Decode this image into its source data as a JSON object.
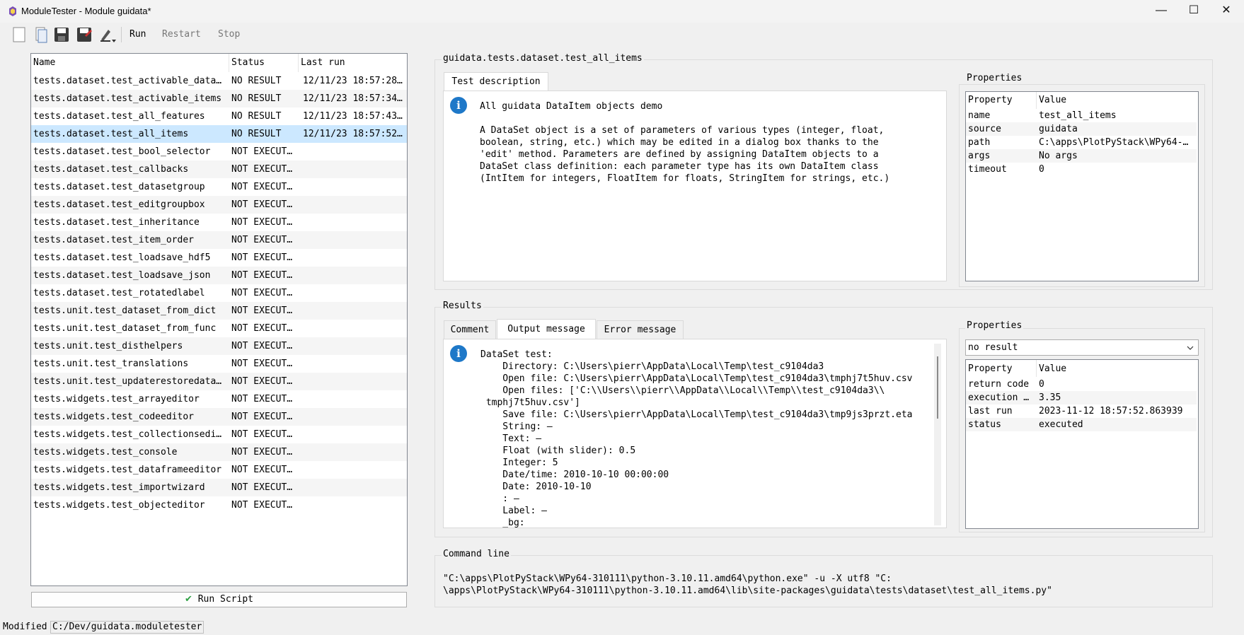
{
  "window": {
    "title": "ModuleTester - Module guidata*",
    "minimize": "—",
    "maximize": "☐",
    "close": "✕"
  },
  "toolbar": {
    "run": "Run",
    "restart": "Restart",
    "stop": "Stop"
  },
  "tree": {
    "headers": {
      "name": "Name",
      "status": "Status",
      "last_run": "Last run"
    },
    "rows": [
      {
        "name": "tests.dataset.test_activable_data…",
        "status": "NO RESULT",
        "last_run": "12/11/23 18:57:28…"
      },
      {
        "name": "tests.dataset.test_activable_items",
        "status": "NO RESULT",
        "last_run": "12/11/23 18:57:34…"
      },
      {
        "name": "tests.dataset.test_all_features",
        "status": "NO RESULT",
        "last_run": "12/11/23 18:57:43…"
      },
      {
        "name": "tests.dataset.test_all_items",
        "status": "NO RESULT",
        "last_run": "12/11/23 18:57:52…"
      },
      {
        "name": "tests.dataset.test_bool_selector",
        "status": "NOT EXECUT…",
        "last_run": ""
      },
      {
        "name": "tests.dataset.test_callbacks",
        "status": "NOT EXECUT…",
        "last_run": ""
      },
      {
        "name": "tests.dataset.test_datasetgroup",
        "status": "NOT EXECUT…",
        "last_run": ""
      },
      {
        "name": "tests.dataset.test_editgroupbox",
        "status": "NOT EXECUT…",
        "last_run": ""
      },
      {
        "name": "tests.dataset.test_inheritance",
        "status": "NOT EXECUT…",
        "last_run": ""
      },
      {
        "name": "tests.dataset.test_item_order",
        "status": "NOT EXECUT…",
        "last_run": ""
      },
      {
        "name": "tests.dataset.test_loadsave_hdf5",
        "status": "NOT EXECUT…",
        "last_run": ""
      },
      {
        "name": "tests.dataset.test_loadsave_json",
        "status": "NOT EXECUT…",
        "last_run": ""
      },
      {
        "name": "tests.dataset.test_rotatedlabel",
        "status": "NOT EXECUT…",
        "last_run": ""
      },
      {
        "name": "tests.unit.test_dataset_from_dict",
        "status": "NOT EXECUT…",
        "last_run": ""
      },
      {
        "name": "tests.unit.test_dataset_from_func",
        "status": "NOT EXECUT…",
        "last_run": ""
      },
      {
        "name": "tests.unit.test_disthelpers",
        "status": "NOT EXECUT…",
        "last_run": ""
      },
      {
        "name": "tests.unit.test_translations",
        "status": "NOT EXECUT…",
        "last_run": ""
      },
      {
        "name": "tests.unit.test_updaterestoredata…",
        "status": "NOT EXECUT…",
        "last_run": ""
      },
      {
        "name": "tests.widgets.test_arrayeditor",
        "status": "NOT EXECUT…",
        "last_run": ""
      },
      {
        "name": "tests.widgets.test_codeeditor",
        "status": "NOT EXECUT…",
        "last_run": ""
      },
      {
        "name": "tests.widgets.test_collectionsedi…",
        "status": "NOT EXECUT…",
        "last_run": ""
      },
      {
        "name": "tests.widgets.test_console",
        "status": "NOT EXECUT…",
        "last_run": ""
      },
      {
        "name": "tests.widgets.test_dataframeeditor",
        "status": "NOT EXECUT…",
        "last_run": ""
      },
      {
        "name": "tests.widgets.test_importwizard",
        "status": "NOT EXECUT…",
        "last_run": ""
      },
      {
        "name": "tests.widgets.test_objecteditor",
        "status": "NOT EXECUT…",
        "last_run": ""
      }
    ],
    "selected_index": 3
  },
  "run_script_label": "Run Script",
  "module_title": "guidata.tests.dataset.test_all_items",
  "description": {
    "tab": "Test description",
    "text": "All guidata DataItem objects demo\n\nA DataSet object is a set of parameters of various types (integer, float,\nboolean, string, etc.) which may be edited in a dialog box thanks to the\n'edit' method. Parameters are defined by assigning DataItem objects to a\nDataSet class definition: each parameter type has its own DataItem class\n(IntItem for integers, FloatItem for floats, StringItem for strings, etc.)"
  },
  "properties": {
    "title": "Properties",
    "col_property": "Property",
    "col_value": "Value",
    "rows": [
      {
        "key": "name",
        "value": "test_all_items"
      },
      {
        "key": "source",
        "value": "guidata"
      },
      {
        "key": "path",
        "value": "C:\\apps\\PlotPyStack\\WPy64-…"
      },
      {
        "key": "args",
        "value": "No args"
      },
      {
        "key": "timeout",
        "value": "0"
      }
    ]
  },
  "results": {
    "title": "Results",
    "tabs": [
      "Comment",
      "Output message",
      "Error message"
    ],
    "active_tab": 1,
    "output": "DataSet test:\n    Directory: C:\\Users\\pierr\\AppData\\Local\\Temp\\test_c9104da3\n    Open file: C:\\Users\\pierr\\AppData\\Local\\Temp\\test_c9104da3\\tmphj7t5huv.csv\n    Open files: ['C:\\\\Users\\\\pierr\\\\AppData\\\\Local\\\\Temp\\\\test_c9104da3\\\\\n tmphj7t5huv.csv']\n    Save file: C:\\Users\\pierr\\AppData\\Local\\Temp\\test_c9104da3\\tmp9js3przt.eta\n    String: –\n    Text: –\n    Float (with slider): 0.5\n    Integer: 5\n    Date/time: 2010-10-10 00:00:00\n    Date: 2010-10-10\n    : –\n    Label: –\n    _bg:",
    "properties_title": "Properties",
    "combo_value": "no result",
    "col_property": "Property",
    "col_value": "Value",
    "rows": [
      {
        "key": "return code",
        "value": "0"
      },
      {
        "key": "execution …",
        "value": "3.35"
      },
      {
        "key": "last run",
        "value": "2023-11-12 18:57:52.863939"
      },
      {
        "key": "status",
        "value": "executed"
      }
    ]
  },
  "command_line": {
    "title": "Command line",
    "text": "\"C:\\apps\\PlotPyStack\\WPy64-310111\\python-3.10.11.amd64\\python.exe\" -u -X utf8 \"C:\n\\apps\\PlotPyStack\\WPy64-310111\\python-3.10.11.amd64\\lib\\site-packages\\guidata\\tests\\dataset\\test_all_items.py\""
  },
  "statusbar": {
    "modified": "Modified",
    "path": "C:/Dev/guidata.moduletester"
  },
  "colors": {
    "selection": "#cce8ff",
    "info_icon": "#1e78c8",
    "run_check": "#2ea043"
  }
}
